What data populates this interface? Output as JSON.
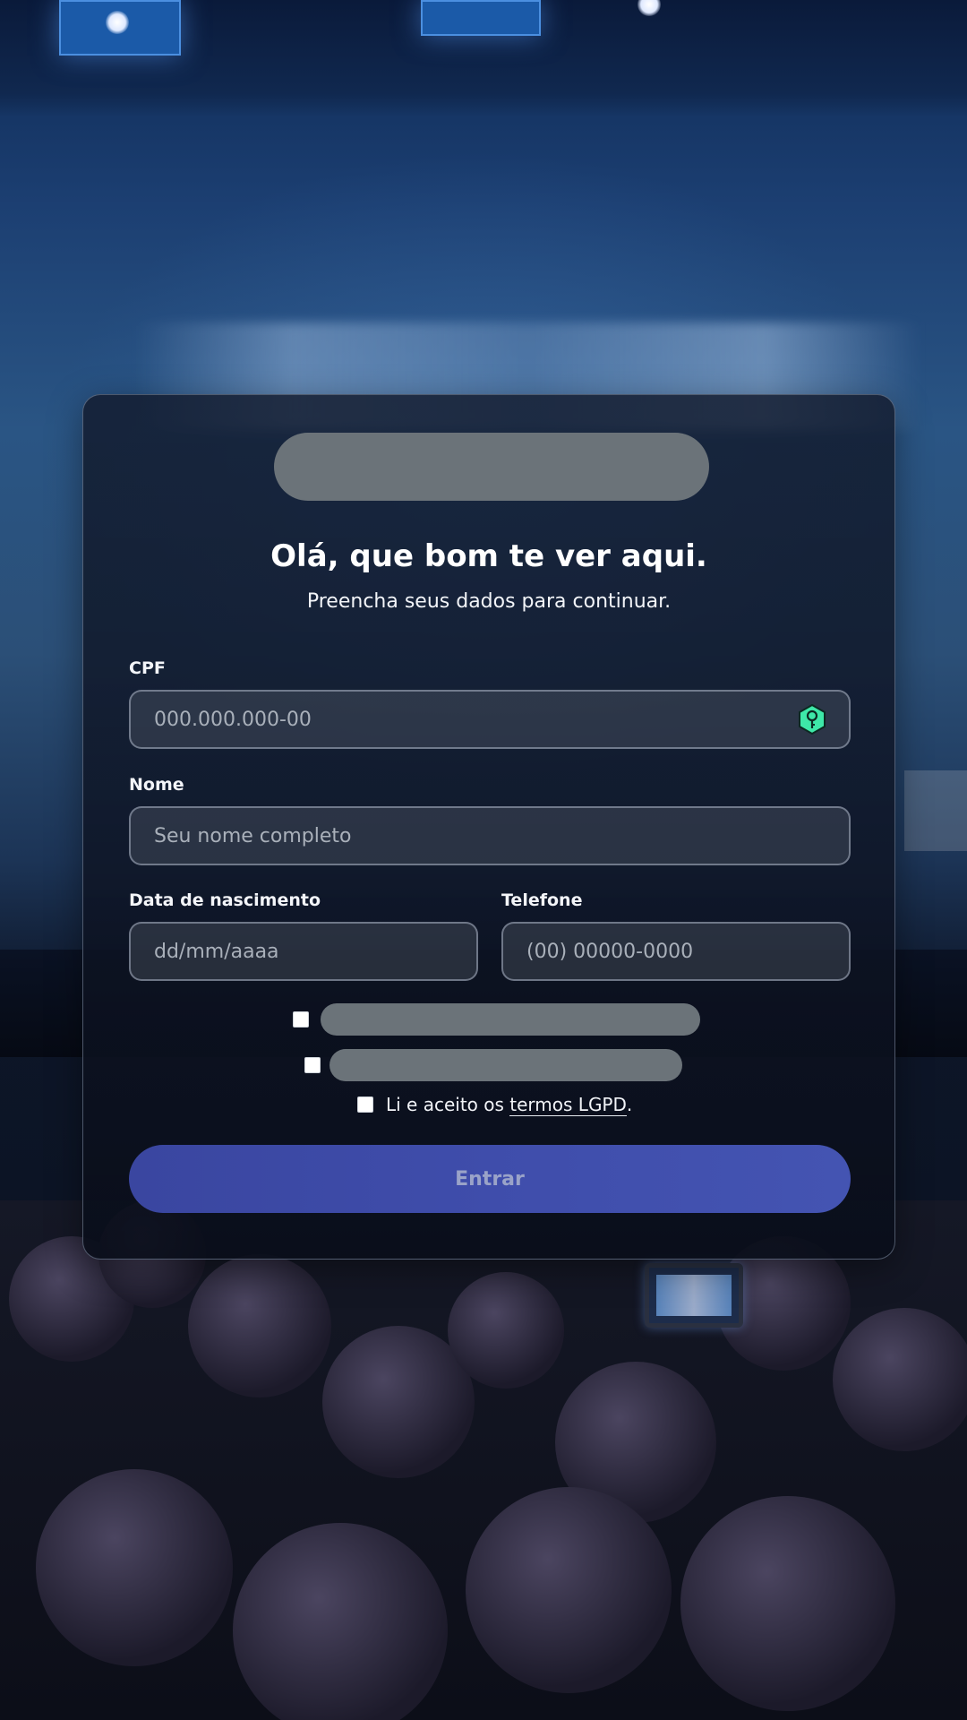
{
  "form": {
    "title": "Olá, que bom te ver aqui.",
    "subtitle": "Preencha seus dados para continuar.",
    "cpf": {
      "label": "CPF",
      "placeholder": "000.000.000-00",
      "icon": "key-hexagon-icon"
    },
    "nome": {
      "label": "Nome",
      "placeholder": "Seu nome completo"
    },
    "nascimento": {
      "label": "Data de nascimento",
      "placeholder": "dd/mm/aaaa"
    },
    "telefone": {
      "label": "Telefone",
      "placeholder": "(00) 00000-0000"
    },
    "terms": {
      "prefix": "Li e aceito os ",
      "link": "termos LGPD",
      "suffix": "."
    },
    "submit_label": "Entrar"
  },
  "colors": {
    "button": "#3f4dab",
    "key_icon": "#3ee8a8",
    "placeholder_bar": "#6b7379"
  }
}
